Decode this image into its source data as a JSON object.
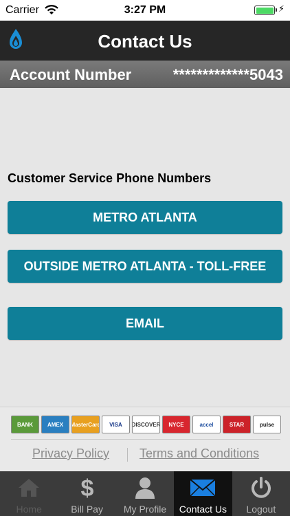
{
  "status_bar": {
    "carrier": "Carrier",
    "time": "3:27 PM",
    "icons": [
      "wifi-icon",
      "battery-icon",
      "charging-bolt-icon"
    ],
    "battery_color": "#4cd964"
  },
  "header": {
    "title": "Contact Us",
    "logo_icon": "flame-logo-icon",
    "logo_color": "#1a8ed6"
  },
  "account": {
    "label": "Account Number",
    "value": "*************5043"
  },
  "content": {
    "heading": "Customer Service Phone Numbers",
    "buttons": {
      "metro": "METRO ATLANTA",
      "outside": "OUTSIDE METRO ATLANTA - TOLL-FREE",
      "email": "EMAIL"
    },
    "button_color": "#0f7f98"
  },
  "footer": {
    "cards": [
      {
        "name": "BANK",
        "bg": "#5a9a3a",
        "fg": "#ffffff"
      },
      {
        "name": "AMEX",
        "bg": "#2a7fc0",
        "fg": "#ffffff"
      },
      {
        "name": "MasterCard",
        "bg": "#e8a020",
        "fg": "#ffffff"
      },
      {
        "name": "VISA",
        "bg": "#ffffff",
        "fg": "#1a3a8a"
      },
      {
        "name": "DISCOVER",
        "bg": "#ffffff",
        "fg": "#333333"
      },
      {
        "name": "NYCE",
        "bg": "#d8262e",
        "fg": "#ffffff"
      },
      {
        "name": "accel",
        "bg": "#ffffff",
        "fg": "#1f4fa0"
      },
      {
        "name": "STAR",
        "bg": "#cc2229",
        "fg": "#ffffff"
      },
      {
        "name": "pulse",
        "bg": "#ffffff",
        "fg": "#222222"
      }
    ],
    "privacy": "Privacy Policy",
    "terms": "Terms and Conditions"
  },
  "tabs": [
    {
      "label": "Home",
      "icon": "home-icon",
      "state": "disabled"
    },
    {
      "label": "Bill Pay",
      "icon": "dollar-icon",
      "state": "normal"
    },
    {
      "label": "My Profile",
      "icon": "person-icon",
      "state": "normal"
    },
    {
      "label": "Contact Us",
      "icon": "envelope-icon",
      "state": "active"
    },
    {
      "label": "Logout",
      "icon": "power-icon",
      "state": "normal"
    }
  ]
}
